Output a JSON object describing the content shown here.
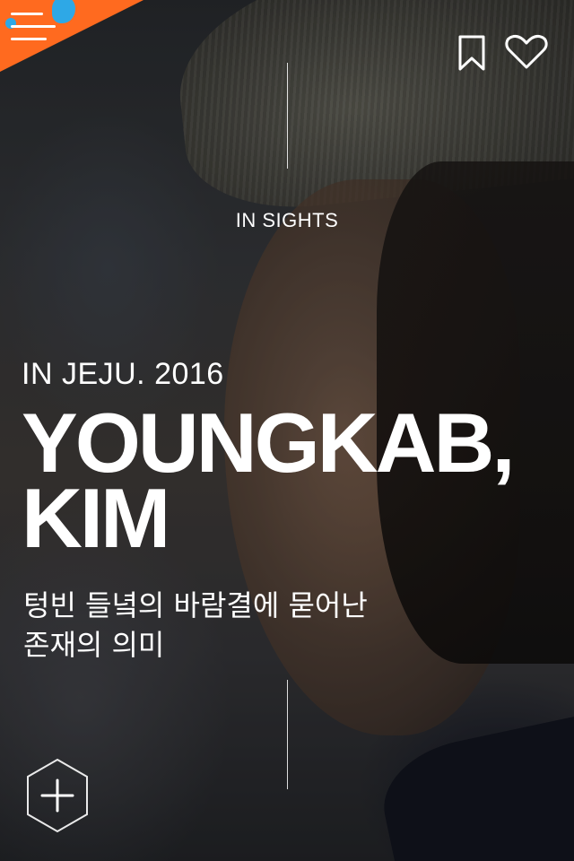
{
  "header": {
    "menu_icon": "hamburger-menu-icon",
    "bookmark_icon": "bookmark-icon",
    "favorite_icon": "heart-icon",
    "accent_color": "#ff6a1f",
    "accent_secondary": "#2ea8e6"
  },
  "article": {
    "section": "IN SIGHTS",
    "subtitle": "IN JEJU. 2016",
    "title_line1": "YOUNGKAB,",
    "title_line2": "KIM",
    "korean_line1": "텅빈 들녘의 바람결에 묻어난",
    "korean_line2": "존재의 의미"
  },
  "footer": {
    "expand_icon": "plus-hexagon-icon"
  }
}
